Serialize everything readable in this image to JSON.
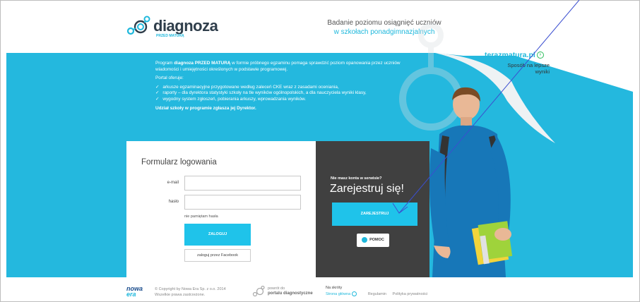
{
  "header": {
    "logo_text": "diagnoza",
    "logo_sub": "PRZED MATURĄ",
    "tagline_line1": "Badanie poziomu osiągnięć uczniów",
    "tagline_line2": "w szkołach ponadgimnazjalnych"
  },
  "promo": {
    "brand": "terazmatura.pl",
    "subtitle": "Sposób na lepsze wyniki"
  },
  "intro": {
    "p1_prefix": "Program ",
    "p1_bold": "diagnoza PRZED MATURĄ",
    "p1_rest": " w formie próbnego egzaminu pomaga sprawdzić poziom opanowania przez uczniów wiadomości i umiejętności określonych w podstawie programowej.",
    "offers_title": "Portal oferuje:",
    "offers": [
      "arkusze egzaminacyjne przygotowane według zaleceń CKE wraz z zasadami oceniania,",
      "raporty – dla dyrektora statystyki szkoły na tle wyników ogólnopolskich, a dla nauczyciela wyniki klasy,",
      "wygodny system zgłoszeń, pobierania arkuszy, wprowadzania wyników."
    ],
    "closing": "Udział szkoły w programie zgłasza jej Dyrektor."
  },
  "login": {
    "title": "Formularz logowania",
    "email_label": "e-mail",
    "email_value": "",
    "password_label": "hasło",
    "password_value": "",
    "forgot": "nie pamiętam hasła",
    "submit": "ZALOGUJ",
    "facebook": "zaloguj przez Facebook"
  },
  "register": {
    "question": "Nie masz konta w serwisie?",
    "headline": "Zarejestruj się!",
    "button": "ZAREJESTRUJ",
    "help": "POMOC"
  },
  "footer": {
    "brand_line1": "nowa",
    "brand_line2": "era",
    "copyright_line1": "© Copyright by Nowa Era Sp. z o.o. 2014",
    "copyright_line2": "Wszelkie prawa zastrzeżone.",
    "portal_line1": "powrót do",
    "portal_line2": "portalu diagnostyczne",
    "shortcuts_title": "Na skróty",
    "links": [
      "Strona główna",
      "Regulamin",
      "Polityka prywatności"
    ]
  },
  "colors": {
    "accent": "#1fc3ea",
    "band": "#24b8de",
    "dark_panel": "#404040",
    "annotation": "#3b4fd0"
  }
}
